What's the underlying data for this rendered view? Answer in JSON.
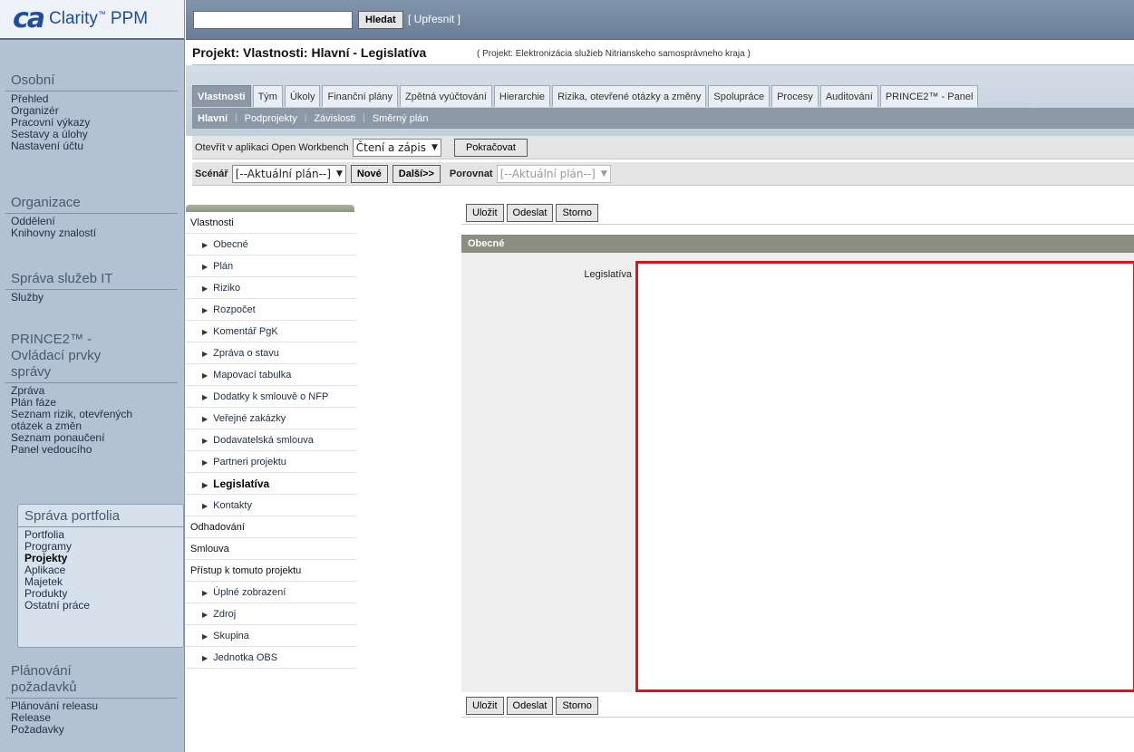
{
  "logo": {
    "mark": "ca",
    "product": "Clarity",
    "tm": "™",
    "suffix": "PPM"
  },
  "search": {
    "value": "",
    "button_label": "Hledat",
    "refine_label": "[ Upřesnit ]"
  },
  "nav": {
    "osobni": {
      "heading": "Osobní",
      "items": [
        "Přehled",
        "Organizér",
        "Pracovní výkazy",
        "Sestavy a úlohy",
        "Nastavení účtu"
      ]
    },
    "organizace": {
      "heading": "Organizace",
      "items": [
        "Oddělení",
        "Knihovny znalostí"
      ]
    },
    "sprava_it": {
      "heading": "Správa služeb IT",
      "items": [
        "Služby"
      ]
    },
    "prince": {
      "heading_lines": [
        "PRINCE2™ -",
        "Ovládací prvky",
        "správy"
      ],
      "items": [
        "Zpráva",
        "Plán fáze",
        "Seznam rizik, otevřených",
        "otázek a změn",
        "Seznam ponaučení",
        "Panel vedoucího"
      ]
    },
    "portfolio": {
      "heading": "Správa portfolia",
      "items": [
        "Portfolia",
        "Programy",
        "Projekty",
        "Aplikace",
        "Majetek",
        "Produkty",
        "Ostatní práce"
      ],
      "active_index": 2
    },
    "planovani": {
      "heading_lines": [
        "Plánování",
        "požadavků"
      ],
      "items": [
        "Plánování releasu",
        "Release",
        "Požadavky"
      ]
    }
  },
  "page": {
    "title": "Projekt: Vlastnosti: Hlavní - Legislatíva",
    "subtitle": "( Projekt: Elektronizácia služieb Nitrianskeho samosprávneho kraja )"
  },
  "tabs": [
    "Vlastnosti",
    "Tým",
    "Úkoly",
    "Finanční plány",
    "Zpětná vyúčtování",
    "Hierarchie",
    "Rizika, otevřené otázky a změny",
    "Spolupráce",
    "Procesy",
    "Auditování",
    "PRINCE2™ - Panel"
  ],
  "subtabs": [
    "Hlavní",
    "Podprojekty",
    "Závislosti",
    "Směrný plán"
  ],
  "owb": {
    "label": "Otevřít v aplikaci Open Workbench",
    "select_value": "Čtení a zápis",
    "continue_label": "Pokračovat"
  },
  "scenario": {
    "label": "Scénář",
    "select_value": "[--Aktuální plán--]",
    "new_label": "Nové",
    "next_label": "Další>>",
    "compare_label": "Porovnat",
    "compare_value": "[--Aktuální plán--]"
  },
  "tree": {
    "root1": "Vlastnosti",
    "children1": [
      "Obecné",
      "Plán",
      "Riziko",
      "Rozpočet",
      "Komentář PgK",
      "Zpráva o stavu",
      "Mapovací tabulka",
      "Dodatky k smlouvě o NFP",
      "Veřejné zakázky",
      "Dodavatelská smlouva",
      "Partneri projektu",
      "Legislatíva",
      "Kontakty"
    ],
    "selected": "Legislatíva",
    "root2": "Odhadování",
    "root3": "Smlouva",
    "root4": "Přístup k tomuto projektu",
    "children4": [
      "Úplné zobrazení",
      "Zdroj",
      "Skupina",
      "Jednotka OBS"
    ]
  },
  "form": {
    "save_label": "Uložit",
    "submit_label": "Odeslat",
    "cancel_label": "Storno",
    "section_title": "Obecné",
    "field_label": "Legislatíva",
    "field_value": ""
  },
  "colors": {
    "highlight_border": "#e0131a",
    "tab_active": "#8c98a6",
    "section_bar": "#8a8f80"
  }
}
